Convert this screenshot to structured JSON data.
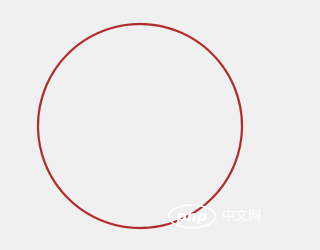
{
  "canvas": {
    "background_color": "#f0f0f0"
  },
  "shape": {
    "type": "circle",
    "stroke_color": "#b22a2a",
    "fill": "none"
  },
  "watermark": {
    "logo_text": "php",
    "site_text": "中文网",
    "text_color": "#ffffff"
  }
}
